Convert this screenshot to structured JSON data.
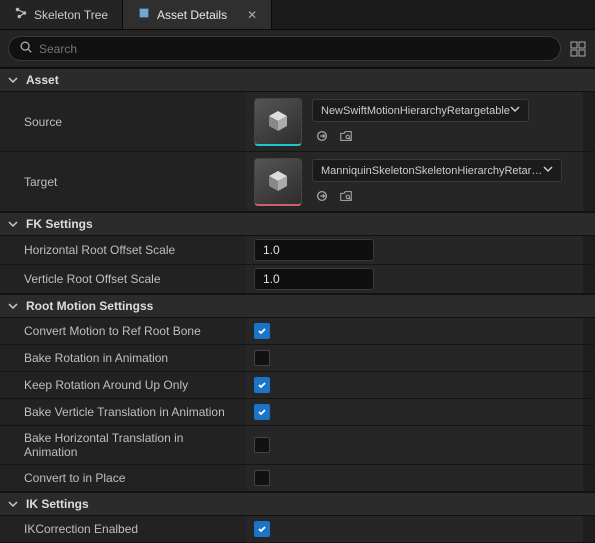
{
  "tabs": {
    "skeletonTree": "Skeleton Tree",
    "assetDetails": "Asset Details"
  },
  "search": {
    "placeholder": "Search"
  },
  "sections": {
    "asset": {
      "title": "Asset",
      "source": {
        "label": "Source",
        "value": "NewSwiftMotionHierarchyRetargetable"
      },
      "target": {
        "label": "Target",
        "value": "ManniquinSkeletonSkeletonHierarchyRetargel"
      }
    },
    "fk": {
      "title": "FK Settings",
      "hroot": {
        "label": "Horizontal Root Offset Scale",
        "value": "1.0"
      },
      "vroot": {
        "label": "Verticle Root Offset Scale",
        "value": "1.0"
      }
    },
    "rootMotion": {
      "title": "Root Motion Settingss",
      "convRef": {
        "label": "Convert Motion to Ref Root Bone",
        "checked": true
      },
      "bakeRot": {
        "label": "Bake Rotation in Animation",
        "checked": false
      },
      "keepRot": {
        "label": "Keep Rotation Around Up Only",
        "checked": true
      },
      "bakeVert": {
        "label": "Bake Verticle Translation in Animation",
        "checked": true
      },
      "bakeHorz": {
        "label": "Bake Horizontal Translation in Animation",
        "checked": false
      },
      "inPlace": {
        "label": "Convert to in Place",
        "checked": false
      }
    },
    "ik": {
      "title": "IK Settings",
      "ikcorr": {
        "label": "IKCorrection Enalbed",
        "checked": true
      }
    }
  }
}
